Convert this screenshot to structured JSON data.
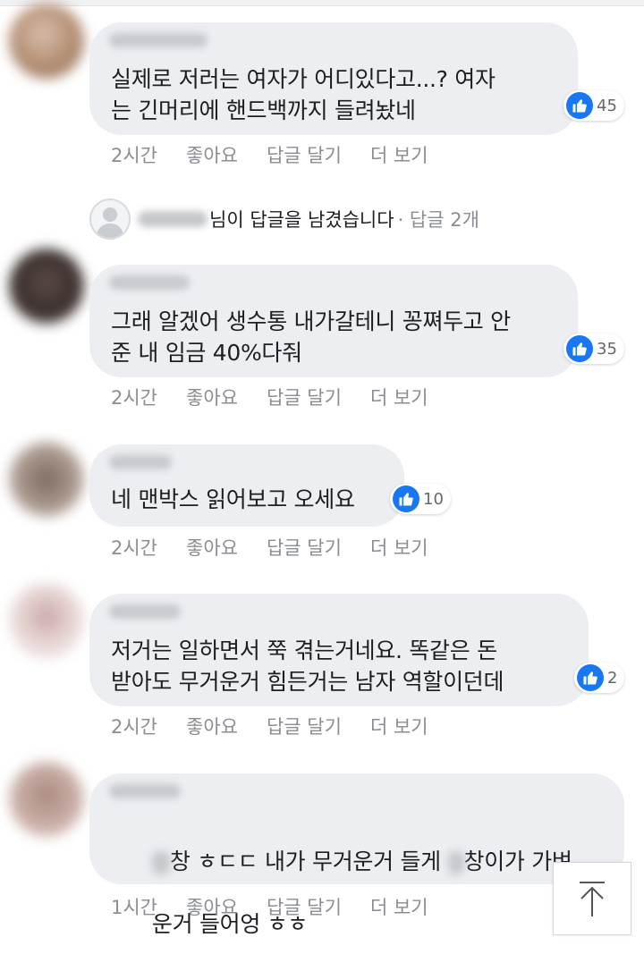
{
  "comments": [
    {
      "text": "실제로 저러는 여자가 어디있다고...? 여자\n는 긴머리에 핸드백까지 들려놨네",
      "likes": "45",
      "time": "2시간",
      "like_label": "좋아요",
      "reply_label": "답글 달기",
      "more_label": "더 보기"
    },
    {
      "text": "그래 알겠어 생수통 내가갈테니 꽁쪄두고 안\n준 내 임금 40%다줘",
      "likes": "35",
      "time": "2시간",
      "like_label": "좋아요",
      "reply_label": "답글 달기",
      "more_label": "더 보기"
    },
    {
      "text": "네 맨박스 읽어보고 오세요",
      "likes": "10",
      "time": "2시간",
      "like_label": "좋아요",
      "reply_label": "답글 달기",
      "more_label": "더 보기"
    },
    {
      "text": "저거는 일하면서 쭉 겪는거네요. 똑같은 돈\n받아도 무거운거 힘든거는 남자 역할이던데",
      "likes": "2",
      "time": "2시간",
      "like_label": "좋아요",
      "reply_label": "답글 달기",
      "more_label": "더 보기"
    },
    {
      "text_part1": "창 ㅎㄷㄷ 내가 무거운거 들게 ",
      "text_part2": "창이가 가벼",
      "text_line2": "운거 들어엉 ㅎㅎ",
      "time": "1시간",
      "like_label": "좋아요",
      "reply_label": "답글 달기",
      "more_label": "더 보기"
    }
  ],
  "reply_summary": {
    "text": "님이 답글을 남겼습니다",
    "count": "· 답글 2개"
  },
  "icons": {
    "like": "thumbs-up-icon",
    "scroll_top": "arrow-up-icon",
    "default_avatar": "person-silhouette-icon"
  },
  "colors": {
    "bubble": "#eceef2",
    "like_blue": "#1877f2",
    "meta_gray": "#8a8d91"
  }
}
